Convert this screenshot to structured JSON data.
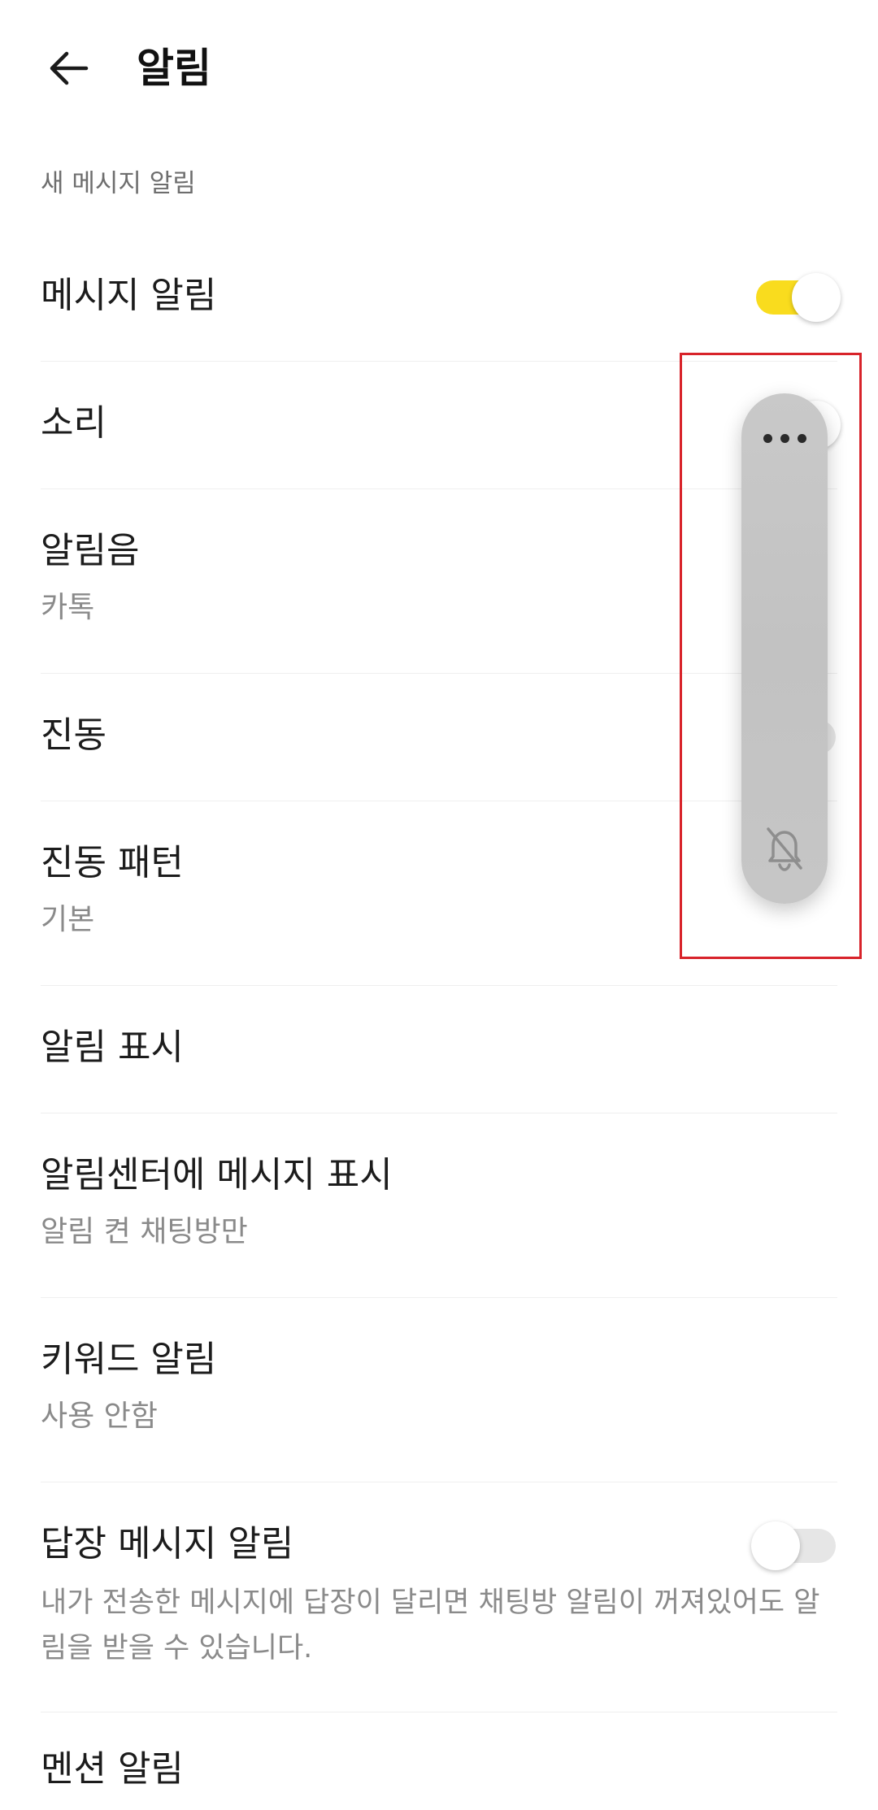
{
  "header": {
    "title": "알림",
    "back_icon": "arrow-left-icon"
  },
  "section": {
    "label": "새 메시지 알림"
  },
  "settings": [
    {
      "title": "메시지 알림",
      "toggle": "on"
    },
    {
      "title": "소리",
      "toggle": "on"
    },
    {
      "title": "알림음",
      "value": "카톡"
    },
    {
      "title": "진동",
      "toggle": "off"
    },
    {
      "title": "진동 패턴",
      "value": "기본"
    },
    {
      "title": "알림 표시"
    },
    {
      "title": "알림센터에 메시지 표시",
      "value": "알림 켠 채팅방만"
    },
    {
      "title": "키워드 알림",
      "value": "사용 안함"
    },
    {
      "title": "답장 메시지 알림",
      "toggle": "off",
      "description": "내가 전송한 메시지에 답장이 달리면 채팅방 알림이 꺼져있어도 알림을 받을 수 있습니다."
    },
    {
      "title": "멘션 알림"
    }
  ],
  "floating_bar": {
    "top_icon": "more-dots-icon",
    "bottom_icon": "bell-off-icon"
  },
  "colors": {
    "toggle_on": "#f9dc1e",
    "toggle_off": "#e6e6e6",
    "highlight": "#d8232a"
  }
}
